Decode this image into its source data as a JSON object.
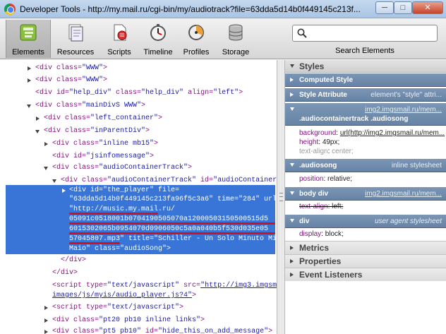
{
  "window": {
    "title": "Developer Tools - http://my.mail.ru/cgi-bin/my/audiotrack?file=63dda5d14b0f449145c213f...",
    "min_label": "─",
    "max_label": "□",
    "close_label": "✕"
  },
  "toolbar": {
    "tabs": [
      {
        "label": "Elements",
        "icon": "elements-icon",
        "active": true
      },
      {
        "label": "Resources",
        "icon": "resources-icon"
      },
      {
        "label": "Scripts",
        "icon": "scripts-icon"
      },
      {
        "label": "Timeline",
        "icon": "timeline-icon"
      },
      {
        "label": "Profiles",
        "icon": "profiles-icon"
      },
      {
        "label": "Storage",
        "icon": "storage-icon"
      }
    ],
    "search_label": "Search Elements",
    "search_value": ""
  },
  "elements": {
    "row0": {
      "pre": "<div class=",
      "val": "\"WWW\"",
      "post": ">"
    },
    "row1": {
      "pre": "<div class=",
      "val": "\"WWW\"",
      "post": ">"
    },
    "row2": {
      "pre": "<div id=",
      "v1": "\"help_div\"",
      "a2": " class=",
      "v2": "\"help_div\"",
      "a3": " align=",
      "v3": "\"left\"",
      "post": ">"
    },
    "row3": {
      "pre": "<div class=",
      "val": "\"mainDivS WWW\"",
      "post": ">"
    },
    "row4": {
      "pre": "<div class=",
      "val": "\"left_container\"",
      "post": ">"
    },
    "row5": {
      "pre": "<div class=",
      "val": "\"inParentDiv\"",
      "post": ">"
    },
    "row6": {
      "pre": "<div class=",
      "val": "\"inline mb15\"",
      "post": ">"
    },
    "row7": {
      "pre": "<div id=",
      "val": "\"jsinfomessage\"",
      "post": ">"
    },
    "row8": {
      "pre": "<div class=",
      "val": "\"audioContainerTrack\"",
      "post": ">"
    },
    "row9": {
      "pre": "<div class=",
      "val": "\"audioContainerTrack\"",
      "a2": " id=",
      "v2": "\"audioContainer\"",
      "post": ">"
    },
    "selected": [
      "<div id=\"the_player\" file=",
      "\"63dda5d14b0f449145c213fa96f5c3a6\" time=\"284\" url=",
      "\"http://music.my.mail.ru/",
      "05091c0518001b0704190505070a12000503150500515d5",
      "6015302065b0954070d0906050c5a0a040b5f530d035e05",
      "57045807.mp3\" title=\"Schiller - Un Solo Minuto Mit Odette Di",
      "Maio\" class=\"audioSong\">"
    ],
    "close1": "</div>",
    "close2": "</div>",
    "script1": {
      "pre": "<script type=",
      "v1": "\"text/javascript\"",
      "a2": " src=",
      "link": "\"http://img3.imgsmail.ru/mail/ru/",
      "link2": "images/js/myis/audio_player.js?4\"",
      "post": ">"
    },
    "script2": {
      "pre": "<script type=",
      "val": "\"text/javascript\"",
      "post": ">"
    },
    "row_pt20": {
      "pre": "<div class=",
      "val": "\"pt20 pb10 inline links\"",
      "post": ">"
    },
    "row_pt5": {
      "pre": "<div class=",
      "v1": "\"pt5 pb10\"",
      "a2": " id=",
      "v2": "\"hide_this_on_add_message\"",
      "post": ">"
    }
  },
  "styles": {
    "header": "Styles",
    "computed": "Computed Style",
    "style_attr": "Style Attribute",
    "style_attr_note": "element's \"style\" attri...",
    "rule1": {
      "source": "img2.imgsmail.ru/mem...",
      "selector": ".audiocontainertrack .audiosong",
      "props": [
        {
          "name": "background",
          "value": "url(http://img2.imgsmail.ru/mem..."
        },
        {
          "name": "height",
          "value": "49px;"
        },
        {
          "name": "text-align",
          "value": "center;"
        }
      ]
    },
    "rule2": {
      "selector": ".audiosong",
      "source": "inline stylesheet",
      "prop_name": "position",
      "prop_value": "relative;"
    },
    "rule3": {
      "selector": "body div",
      "source": "img2.imgsmail.ru/mem...",
      "prop_name": "text-align",
      "prop_value": "left;"
    },
    "rule4": {
      "selector": "div",
      "source": "user agent stylesheet",
      "prop_name": "display",
      "prop_value": "block;"
    },
    "metrics": "Metrics",
    "properties": "Properties",
    "event_listeners": "Event Listeners"
  }
}
